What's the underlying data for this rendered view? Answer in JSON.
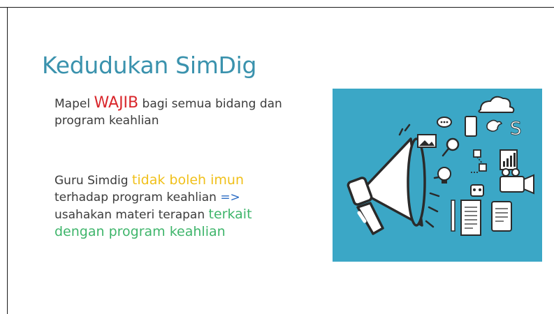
{
  "slide": {
    "title": "Kedudukan SimDig",
    "para1": {
      "before": "Mapel ",
      "highlight": "WAJIB",
      "after": " bagi semua bidang dan program keahlian"
    },
    "para2": {
      "t1": "Guru Simdig ",
      "h1": "tidak boleh imun",
      "t2": " terhadap program keahlian ",
      "arrow": "=>",
      "t3": " usahakan materi terapan ",
      "h2": "terkait dengan program keahlian"
    },
    "illustration": {
      "icon": "megaphone-icon",
      "colors": {
        "background": "#3ba7c6",
        "foreground": "#ffffff",
        "accent": "#2a2a2a"
      }
    }
  }
}
